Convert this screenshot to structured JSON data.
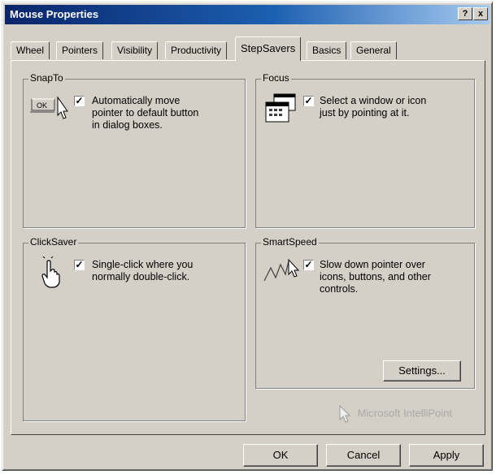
{
  "window": {
    "title": "Mouse Properties"
  },
  "titlebar": {
    "help": "?",
    "close": "x"
  },
  "tabs": [
    "Wheel",
    "Pointers",
    "Visibility",
    "Productivity",
    "StepSavers",
    "Basics",
    "General"
  ],
  "active_tab": "StepSavers",
  "snapto": {
    "title": "SnapTo",
    "icon_label": "OK",
    "checked": true,
    "label_line1": "Automatically move",
    "label_line2": "pointer to default button",
    "label_line3": "in dialog boxes."
  },
  "focus": {
    "title": "Focus",
    "checked": true,
    "label_line1": "Select a window or icon",
    "label_line2": "just by pointing at it."
  },
  "clicksaver": {
    "title": "ClickSaver",
    "checked": true,
    "label_line1": "Single-click where you",
    "label_line2": "normally double-click."
  },
  "smartspeed": {
    "title": "SmartSpeed",
    "checked": true,
    "label_line1": "Slow down pointer over",
    "label_line2": "icons, buttons, and other",
    "label_line3": "controls.",
    "settings_button": "Settings..."
  },
  "brand": "Microsoft IntelliPoint",
  "buttons": {
    "ok": "OK",
    "cancel": "Cancel",
    "apply": "Apply"
  },
  "icons": {
    "snapto": "snapto-pointer-icon",
    "focus": "window-focus-icon",
    "clicksaver": "hand-click-icon",
    "smartspeed": "slow-pointer-icon",
    "brand": "intellipoint-cursor-icon"
  }
}
